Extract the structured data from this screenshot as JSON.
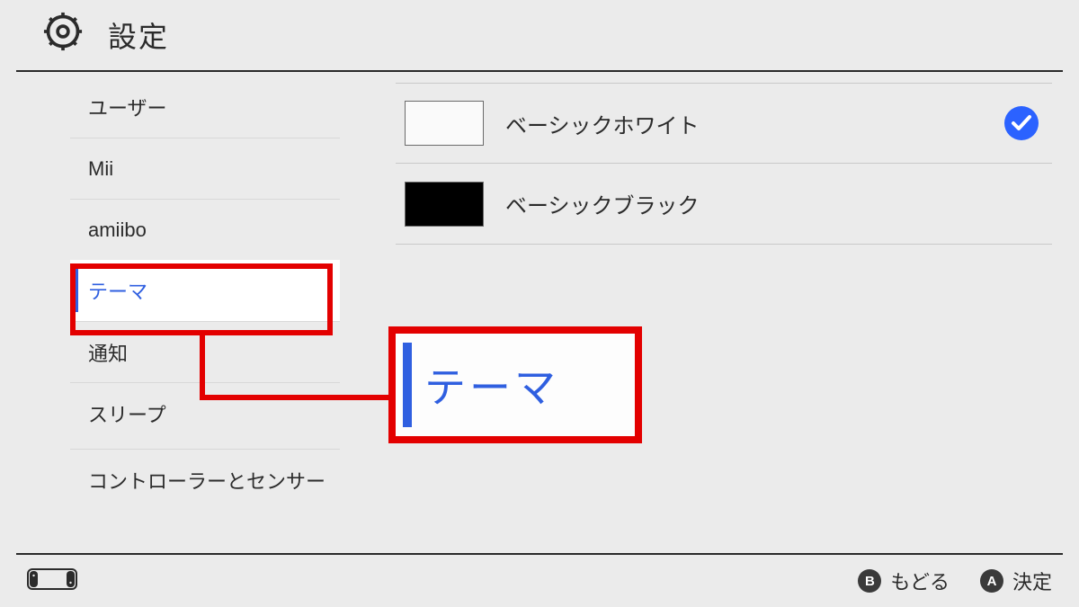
{
  "header": {
    "title": "設定"
  },
  "sidebar": {
    "items": [
      {
        "label": "ユーザー"
      },
      {
        "label": "Mii"
      },
      {
        "label": "amiibo"
      },
      {
        "label": "テーマ",
        "selected": true
      },
      {
        "label": "通知"
      },
      {
        "label": "スリープ"
      },
      {
        "label": "コントローラーとセンサー"
      }
    ]
  },
  "themes": {
    "options": [
      {
        "label": "ベーシックホワイト",
        "swatch": "white",
        "selected": true
      },
      {
        "label": "ベーシックブラック",
        "swatch": "black",
        "selected": false
      }
    ]
  },
  "callout": {
    "label": "テーマ"
  },
  "footer": {
    "back": {
      "btn": "B",
      "label": "もどる"
    },
    "ok": {
      "btn": "A",
      "label": "決定"
    }
  },
  "colors": {
    "accent": "#2f5fe0",
    "annotation": "#e30000",
    "check": "#2b62ff"
  }
}
